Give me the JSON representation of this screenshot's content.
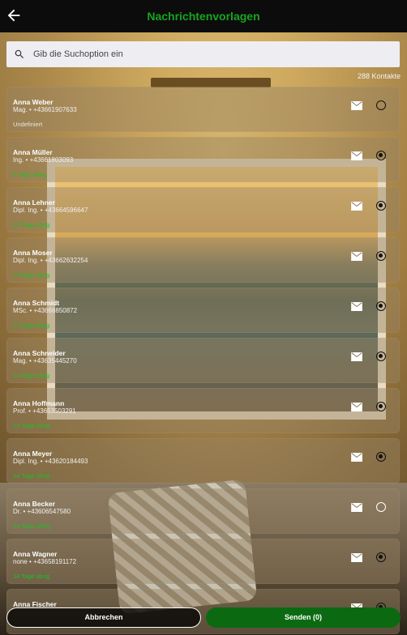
{
  "header": {
    "title": "Nachrichtenvorlagen",
    "back_icon": "arrow-left-icon"
  },
  "search": {
    "placeholder": "Gib die Suchoption ein",
    "value": ""
  },
  "contact_count": "288 Kontakte",
  "contacts": [
    {
      "name": "Anna Weber",
      "sub": "Mag. • +43661907633",
      "status": "Undefiniert",
      "selected": false
    },
    {
      "name": "Anna Müller",
      "sub": "Ing. • +43661803093",
      "status": "6 Tage übrig",
      "selected": true
    },
    {
      "name": "Anna Lehner",
      "sub": "Dipl. Ing. • +43664596647",
      "status": "12 Tage übrig",
      "selected": true
    },
    {
      "name": "Anna Moser",
      "sub": "Dipl. Ing. • +43662632254",
      "status": "13 Tage übrig",
      "selected": true
    },
    {
      "name": "Anna Schmidt",
      "sub": "MSc. • +43666850872",
      "status": "13 Tage übrig",
      "selected": true
    },
    {
      "name": "Anna Schneider",
      "sub": "Mag. • +43635445270",
      "status": "14 Tage übrig",
      "selected": true
    },
    {
      "name": "Anna Hoffmann",
      "sub": "Prof. • +43653503291",
      "status": "14 Tage übrig",
      "selected": true
    },
    {
      "name": "Anna Meyer",
      "sub": "Dipl. Ing. • +43620184493",
      "status": "14 Tage übrig",
      "selected": true
    },
    {
      "name": "Anna Becker",
      "sub": "Dr. • +43606547580",
      "status": "14 Tage übrig",
      "selected": false
    },
    {
      "name": "Anna Wagner",
      "sub": "none • +43658191172",
      "status": "14 Tage übrig",
      "selected": true
    },
    {
      "name": "Anna Fischer",
      "sub": "",
      "status": "",
      "selected": true
    }
  ],
  "buttons": {
    "cancel": "Abbrechen",
    "send": "Senden (0)"
  },
  "colors": {
    "accent_green": "#17a51f",
    "status_green": "#15c525",
    "send_button": "#0b6a11"
  }
}
